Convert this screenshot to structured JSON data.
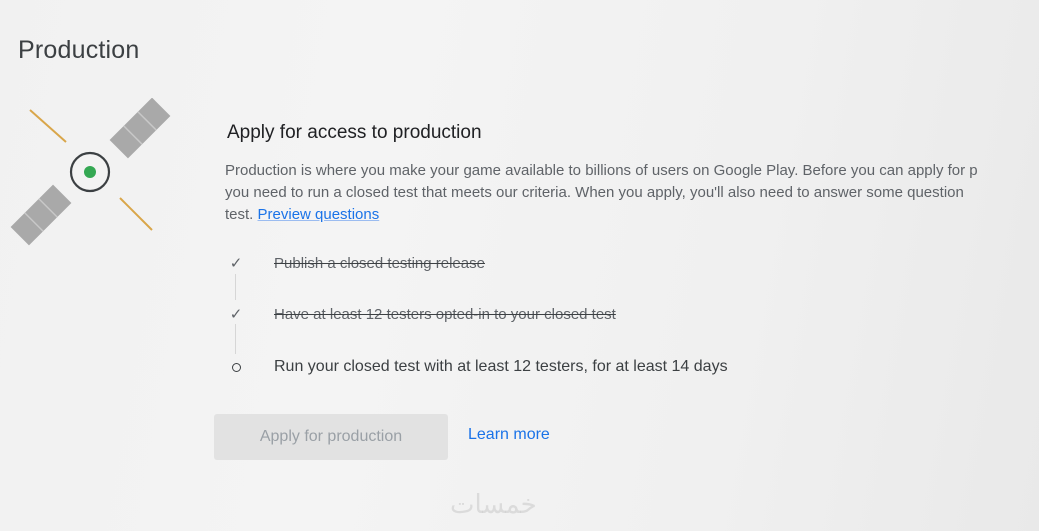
{
  "page": {
    "title": "Production"
  },
  "illustration": {
    "icon": "satellite-icon",
    "accent_color": "#34a853"
  },
  "section": {
    "title": "Apply for access to production",
    "description_line1": "Production is where you make your game available to billions of users on Google Play. Before you can apply for p",
    "description_line2": "you need to run a closed test that meets our criteria. When you apply, you'll also need to answer some question",
    "description_line3_prefix": "test. ",
    "preview_link": "Preview questions"
  },
  "steps": [
    {
      "status": "done",
      "icon": "check-icon",
      "label": "Publish a closed testing release"
    },
    {
      "status": "done",
      "icon": "check-icon",
      "label": "Have at least 12 testers opted-in to your closed test"
    },
    {
      "status": "pending",
      "icon": "circle-icon",
      "label": "Run your closed test with at least 12 testers, for at least 14 days"
    }
  ],
  "actions": {
    "apply_label": "Apply for production",
    "apply_enabled": false,
    "learn_more_label": "Learn more"
  },
  "watermark": {
    "text": "خمسات"
  },
  "colors": {
    "link": "#1a73e8",
    "disabled_button": "#e2e2e2",
    "disabled_text": "#9aa0a6"
  }
}
